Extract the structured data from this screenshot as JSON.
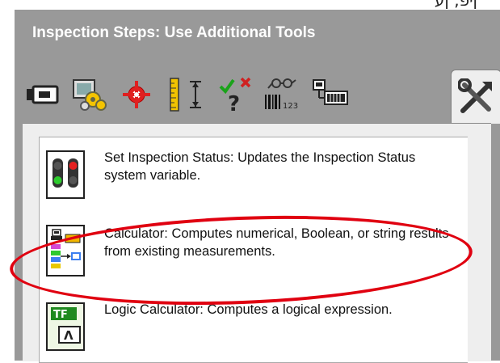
{
  "top_fragment": "ןיפ, ןע",
  "panel": {
    "title": "Inspection Steps: Use Additional Tools"
  },
  "toolbar": {
    "tools": [
      {
        "icon": "camera-acquire-icon"
      },
      {
        "icon": "image-processing-gears-icon"
      },
      {
        "icon": "locate-features-crosshair-icon"
      },
      {
        "icon": "measure-features-ruler-icon"
      },
      {
        "icon": "check-for-presence-icon"
      },
      {
        "icon": "identify-parts-barcode-icon"
      },
      {
        "icon": "communicate-io-icon"
      },
      {
        "icon": "use-additional-tools-icon",
        "active": true
      }
    ]
  },
  "items": [
    {
      "icon": "traffic-light-icon",
      "text": "Set Inspection Status:  Updates the Inspection Status system variable."
    },
    {
      "icon": "calculator-icon",
      "text": "Calculator:  Computes numerical, Boolean, or string results from existing measurements."
    },
    {
      "icon": "logic-calculator-icon",
      "text": "Logic Calculator:  Computes a logical expression."
    }
  ],
  "annotation": {
    "color": "#e00010"
  }
}
